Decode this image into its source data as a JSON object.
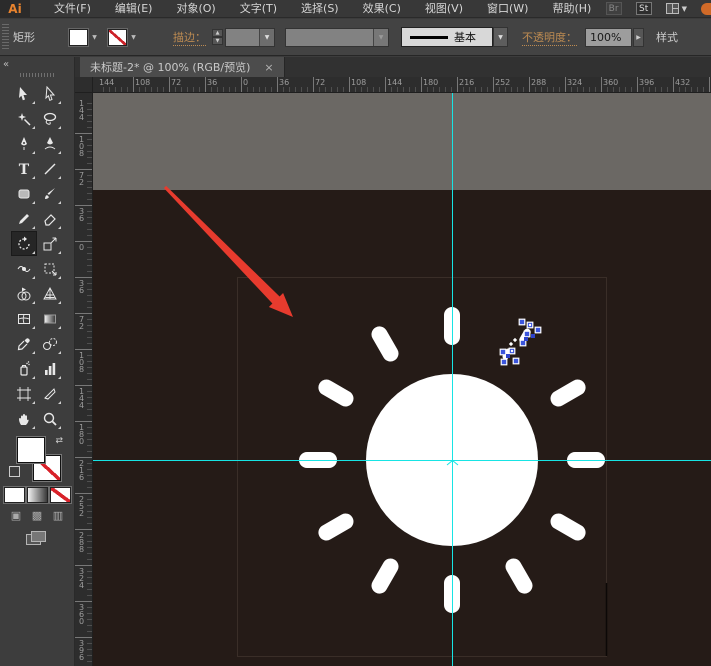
{
  "menubar": {
    "logo": "Ai",
    "items": [
      "文件(F)",
      "编辑(E)",
      "对象(O)",
      "文字(T)",
      "选择(S)",
      "效果(C)",
      "视图(V)",
      "窗口(W)",
      "帮助(H)"
    ],
    "right_buttons": [
      {
        "name": "bridge-button",
        "label": "Br"
      },
      {
        "name": "stock-button",
        "label": "St"
      }
    ]
  },
  "controlbar": {
    "context_label": "矩形",
    "stroke_label": "描边：",
    "brush_value": "基本",
    "opacity_label": "不透明度：",
    "opacity_value": "100%",
    "style_label": "样式"
  },
  "tab": {
    "title": "未标题-2* @ 100% (RGB/预览)",
    "close": "×"
  },
  "rulers": {
    "horizontal": [
      "144",
      "108",
      "72",
      "36",
      "0",
      "36",
      "72",
      "108",
      "144",
      "180",
      "216",
      "252",
      "288",
      "324",
      "360",
      "396",
      "432"
    ],
    "vertical": [
      "144",
      "108",
      "72",
      "36",
      "0",
      "36",
      "72",
      "108",
      "144",
      "180",
      "216",
      "252",
      "288",
      "324",
      "360",
      "396"
    ]
  },
  "toolbar": {
    "collapse": "«",
    "tools": [
      {
        "name": "selection-tool-icon",
        "icon": "selection"
      },
      {
        "name": "direct-selection-tool-icon",
        "icon": "direct-selection"
      },
      {
        "name": "magic-wand-tool-icon",
        "icon": "magic-wand"
      },
      {
        "name": "lasso-tool-icon",
        "icon": "lasso"
      },
      {
        "name": "pen-tool-icon",
        "icon": "pen"
      },
      {
        "name": "curvature-tool-icon",
        "icon": "curvature-pen"
      },
      {
        "name": "type-tool-icon",
        "icon": "type"
      },
      {
        "name": "line-segment-tool-icon",
        "icon": "line"
      },
      {
        "name": "rectangle-tool-icon",
        "icon": "rectangle"
      },
      {
        "name": "paintbrush-tool-icon",
        "icon": "paintbrush"
      },
      {
        "name": "pencil-tool-icon",
        "icon": "pencil"
      },
      {
        "name": "eraser-tool-icon",
        "icon": "eraser"
      },
      {
        "name": "rotate-tool-icon",
        "icon": "rotate",
        "selected": true
      },
      {
        "name": "scale-tool-icon",
        "icon": "scale"
      },
      {
        "name": "width-tool-icon",
        "icon": "width-tool"
      },
      {
        "name": "free-transform-tool-icon",
        "icon": "free-transform"
      },
      {
        "name": "shape-builder-tool-icon",
        "icon": "shape-builder"
      },
      {
        "name": "perspective-grid-tool-icon",
        "icon": "perspective-grid"
      },
      {
        "name": "mesh-tool-icon",
        "icon": "mesh"
      },
      {
        "name": "gradient-tool-icon",
        "icon": "gradient"
      },
      {
        "name": "eyedropper-tool-icon",
        "icon": "eyedropper"
      },
      {
        "name": "blend-tool-icon",
        "icon": "blend"
      },
      {
        "name": "symbol-sprayer-tool-icon",
        "icon": "symbol-sprayer"
      },
      {
        "name": "column-graph-tool-icon",
        "icon": "column-graph"
      },
      {
        "name": "artboard-tool-icon",
        "icon": "artboard"
      },
      {
        "name": "slice-tool-icon",
        "icon": "slice"
      },
      {
        "name": "hand-tool-icon",
        "icon": "hand"
      },
      {
        "name": "zoom-tool-icon",
        "icon": "zoom"
      }
    ],
    "draw_mode_glyphs": [
      "▣",
      "▩",
      "▥"
    ]
  },
  "colors": {
    "guide_cyan": "#17e4e4",
    "canvas_dark": "#251b17",
    "pasteboard_gray": "#6b6864",
    "annotation_red": "#e73b2e",
    "handle_blue": "#3c56dd",
    "sun_white": "#ffffff",
    "accent_orange_label": "#bd8b52"
  }
}
